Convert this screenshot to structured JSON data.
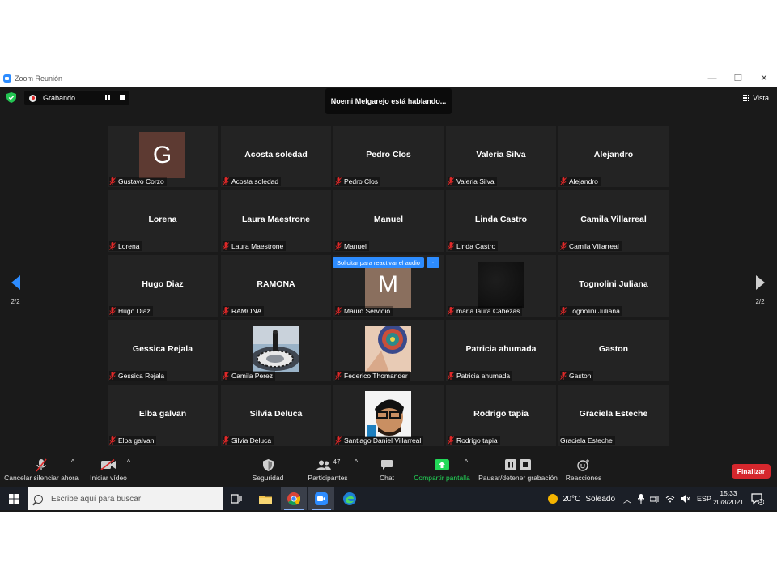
{
  "window": {
    "title": "Zoom Reunión",
    "controls": [
      "—",
      "❐",
      "✕"
    ]
  },
  "recording": {
    "label": "Grabando..."
  },
  "speaking": "Noemi Melgarejo está hablando...",
  "view": {
    "label": "Vista"
  },
  "pager": {
    "left": "2/2",
    "right": "2/2"
  },
  "unmute_popup": {
    "label": "Solicitar para reactivar el audio",
    "more": "···"
  },
  "tiles": [
    {
      "name": "Gustavo Corzo",
      "display": "",
      "avatar": "G",
      "avatar_color": "#5d3a32",
      "muted": true
    },
    {
      "name": "Acosta soledad",
      "display": "Acosta soledad",
      "muted": true
    },
    {
      "name": "Pedro Clos",
      "display": "Pedro Clos",
      "muted": true
    },
    {
      "name": "Valeria Silva",
      "display": "Valeria Silva",
      "muted": true
    },
    {
      "name": "Alejandro",
      "display": "Alejandro",
      "muted": true
    },
    {
      "name": "Lorena",
      "display": "Lorena",
      "muted": true
    },
    {
      "name": "Laura Maestrone",
      "display": "Laura Maestrone",
      "muted": true
    },
    {
      "name": "Manuel",
      "display": "Manuel",
      "muted": true
    },
    {
      "name": "Linda Castro",
      "display": "Linda Castro",
      "muted": true
    },
    {
      "name": "Camila Villarreal",
      "display": "Camila Villarreal",
      "muted": true
    },
    {
      "name": "Hugo Diaz",
      "display": "Hugo Diaz",
      "muted": true
    },
    {
      "name": "RAMONA",
      "display": "RAMONA",
      "muted": true
    },
    {
      "name": "Mauro Servidio",
      "display": "",
      "avatar": "M",
      "avatar_color": "#8a6f5e",
      "muted": true
    },
    {
      "name": "maria laura Cabezas",
      "display": "",
      "photo": "dark",
      "muted": true
    },
    {
      "name": "Tognolini Juliana",
      "display": "Tognolini Juliana",
      "muted": true
    },
    {
      "name": "Gessica Rejala",
      "display": "Gessica Rejala",
      "muted": true
    },
    {
      "name": "Camila Perez",
      "display": "",
      "photo": "mosaic",
      "muted": true
    },
    {
      "name": "Federico Thomander",
      "display": "",
      "photo": "pattern",
      "muted": true
    },
    {
      "name": "Patricia ahumada",
      "display": "Patricia ahumada",
      "muted": true
    },
    {
      "name": "Gaston",
      "display": "Gaston",
      "muted": true
    },
    {
      "name": "Elba galvan",
      "display": "Elba galvan",
      "muted": true
    },
    {
      "name": "Silvia Deluca",
      "display": "Silvia Deluca",
      "muted": true
    },
    {
      "name": "Santiago Daniel Villarreal",
      "display": "",
      "photo": "sketch",
      "muted": true
    },
    {
      "name": "Rodrigo tapia",
      "display": "Rodrigo tapia",
      "muted": true
    },
    {
      "name": "Graciela Esteche",
      "display": "Graciela Esteche",
      "muted": false
    }
  ],
  "toolbar": {
    "mute_label": "Cancelar silenciar ahora",
    "video_label": "Iniciar vídeo",
    "security_label": "Seguridad",
    "participants_label": "Participantes",
    "participants_count": "47",
    "chat_label": "Chat",
    "share_label": "Compartir pantalla",
    "record_label": "Pausar/detener grabación",
    "reactions_label": "Reacciones",
    "end_label": "Finalizar"
  },
  "taskbar": {
    "search_placeholder": "Escribe aquí para buscar",
    "weather_temp": "20°C",
    "weather_desc": "Soleado",
    "language": "ESP",
    "time": "15:33",
    "date": "20/8/2021",
    "notification_count": "3"
  },
  "colors": {
    "accent": "#2d8cff",
    "share": "#23d959",
    "end": "#d6272d",
    "muted": "#e02828"
  }
}
